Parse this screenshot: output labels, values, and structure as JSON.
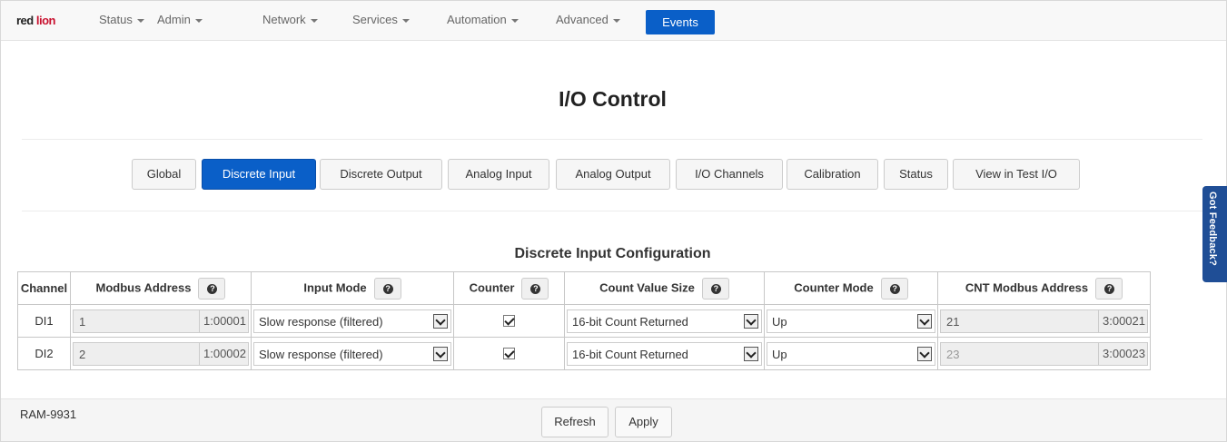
{
  "nav": {
    "logo_part1": "red ",
    "logo_part2": "lion",
    "items": [
      "Status",
      "Admin",
      "Network",
      "Services",
      "Automation",
      "Advanced"
    ],
    "events_label": "Events"
  },
  "page": {
    "title": "I/O Control"
  },
  "tabs": [
    "Global",
    "Discrete Input",
    "Discrete Output",
    "Analog Input",
    "Analog Output",
    "I/O Channels",
    "Calibration",
    "Status",
    "View in Test I/O"
  ],
  "active_tab": "Discrete Input",
  "feedback_label": "Got Feedback?",
  "section": {
    "title": "Discrete Input Configuration"
  },
  "table": {
    "headers": [
      "Channel",
      "Modbus Address",
      "Input Mode",
      "Counter",
      "Count Value Size",
      "Counter Mode",
      "CNT Modbus Address"
    ],
    "rows": [
      {
        "channel": "DI1",
        "modbus_value": "1",
        "modbus_ref": "1:00001",
        "input_mode": "Slow response (filtered)",
        "counter_checked": true,
        "count_size": "16-bit Count Returned",
        "counter_mode": "Up",
        "cnt_value": "21",
        "cnt_ref": "3:00021"
      },
      {
        "channel": "DI2",
        "modbus_value": "2",
        "modbus_ref": "1:00002",
        "input_mode": "Slow response (filtered)",
        "counter_checked": true,
        "count_size": "16-bit Count Returned",
        "counter_mode": "Up",
        "cnt_value": "23",
        "cnt_ref": "3:00023"
      }
    ]
  },
  "footer": {
    "device_id": "RAM-9931",
    "refresh_label": "Refresh",
    "apply_label": "Apply"
  }
}
